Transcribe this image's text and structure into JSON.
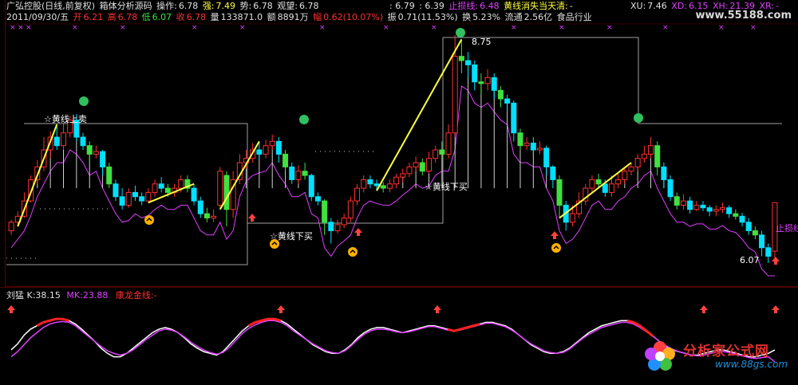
{
  "header": {
    "title": "广弘控股(日线,前复权)",
    "indicator_name": "箱体分析源码",
    "op_label": "操作:",
    "op_value": "6.78",
    "strong_label": "强:",
    "strong_value": "7.49",
    "trend_label": "势:",
    "trend_value": "6.78",
    "watch_label": "观望:",
    "watch_value": "6.78",
    "v1": ": 6.79",
    "v2": ": 6.39",
    "stoploss_label": "止损线:",
    "stoploss_value": "6.48",
    "yellow_gone_label": "黄线消失当天清:",
    "yellow_gone_value": "-",
    "xu_label": "XU:",
    "xu_value": "7.46",
    "xd_label": "XD:",
    "xd_value": "6.15",
    "xh_label": "XH:",
    "xh_value": "21.39",
    "xr_label": "XR:",
    "xr_value": "-",
    "watermark": "www.55188.com",
    "date": "2011/09/30/五",
    "open_label": "开",
    "open_value": "6.21",
    "high_label": "高",
    "high_value": "6.78",
    "low_label": "低",
    "low_value": "6.07",
    "close_label": "收",
    "close_value": "6.78",
    "vol_label": "量",
    "vol_value": "133871.0",
    "amt_label": "额",
    "amt_value": "8891万",
    "chg_label": "幅",
    "chg_value": "0.62(10.07%)",
    "amp_label": "振",
    "amp_value": "0.71(11.53%)",
    "turnover_label": "换",
    "turnover_value": "5.23%",
    "float_label": "流通",
    "float_value": "2.56亿",
    "industry": "食品行业"
  },
  "annotations": {
    "high_price": "8.75",
    "low_price": "6.07",
    "sell_1": "☆黄线上卖",
    "buy_1": "☆黄线下买",
    "buy_2": "☆黄线下买",
    "stoploss_tag": "止损线"
  },
  "sub_panel": {
    "name": "刘猛",
    "k_label": "K:",
    "k_value": "38.15",
    "mk_label": "MK:",
    "mk_value": "23.88",
    "gold_label": "康龙金线:",
    "gold_value": "-"
  },
  "logo": {
    "title": "分析家公式网",
    "url": "www.88gs.com"
  },
  "colors": {
    "up": "#ff3030",
    "down": "#00e0ff",
    "green": "#40e040",
    "yellow": "#ffff40",
    "magenta": "#e040ff",
    "grey_line": "#a0a0a0",
    "white": "#ffffff"
  },
  "chart_data": {
    "type": "candlestick",
    "ylim": [
      6.07,
      8.75
    ],
    "candles": [
      {
        "o": 6.45,
        "c": 6.55,
        "h": 6.58,
        "l": 6.4
      },
      {
        "o": 6.55,
        "c": 6.62,
        "h": 6.68,
        "l": 6.5
      },
      {
        "o": 6.62,
        "c": 6.8,
        "h": 6.9,
        "l": 6.6
      },
      {
        "o": 6.8,
        "c": 7.05,
        "h": 7.1,
        "l": 6.78
      },
      {
        "o": 7.05,
        "c": 7.2,
        "h": 7.28,
        "l": 7.0
      },
      {
        "o": 7.2,
        "c": 7.4,
        "h": 7.55,
        "l": 7.15
      },
      {
        "o": 7.4,
        "c": 7.55,
        "h": 7.62,
        "l": 7.3
      },
      {
        "o": 7.55,
        "c": 7.45,
        "h": 7.7,
        "l": 7.4
      },
      {
        "o": 7.45,
        "c": 7.6,
        "h": 7.72,
        "l": 7.4
      },
      {
        "o": 7.6,
        "c": 7.75,
        "h": 7.8,
        "l": 7.55
      },
      {
        "o": 7.75,
        "c": 7.55,
        "h": 7.82,
        "l": 7.5
      },
      {
        "o": 7.55,
        "c": 7.45,
        "h": 7.6,
        "l": 7.4
      },
      {
        "o": 7.45,
        "c": 7.35,
        "h": 7.5,
        "l": 7.25
      },
      {
        "o": 7.35,
        "c": 7.38,
        "h": 7.45,
        "l": 7.3
      },
      {
        "o": 7.38,
        "c": 7.2,
        "h": 7.4,
        "l": 7.1
      },
      {
        "o": 7.2,
        "c": 7.0,
        "h": 7.25,
        "l": 6.95
      },
      {
        "o": 7.0,
        "c": 6.85,
        "h": 7.05,
        "l": 6.8
      },
      {
        "o": 6.85,
        "c": 6.75,
        "h": 6.95,
        "l": 6.7
      },
      {
        "o": 6.75,
        "c": 6.9,
        "h": 6.95,
        "l": 6.72
      },
      {
        "o": 6.9,
        "c": 6.85,
        "h": 6.98,
        "l": 6.8
      },
      {
        "o": 6.85,
        "c": 6.8,
        "h": 6.9,
        "l": 6.75
      },
      {
        "o": 6.8,
        "c": 6.9,
        "h": 6.95,
        "l": 6.78
      },
      {
        "o": 6.9,
        "c": 7.0,
        "h": 7.05,
        "l": 6.85
      },
      {
        "o": 7.0,
        "c": 6.95,
        "h": 7.08,
        "l": 6.9
      },
      {
        "o": 6.95,
        "c": 6.9,
        "h": 7.0,
        "l": 6.85
      },
      {
        "o": 6.9,
        "c": 6.95,
        "h": 7.0,
        "l": 6.85
      },
      {
        "o": 6.95,
        "c": 7.05,
        "h": 7.1,
        "l": 6.9
      },
      {
        "o": 7.05,
        "c": 6.95,
        "h": 7.1,
        "l": 6.9
      },
      {
        "o": 6.95,
        "c": 6.8,
        "h": 7.0,
        "l": 6.75
      },
      {
        "o": 6.8,
        "c": 6.65,
        "h": 6.85,
        "l": 6.6
      },
      {
        "o": 6.65,
        "c": 6.6,
        "h": 6.72,
        "l": 6.55
      },
      {
        "o": 6.6,
        "c": 6.62,
        "h": 6.7,
        "l": 6.55
      },
      {
        "o": 6.75,
        "c": 7.15,
        "h": 7.2,
        "l": 6.7
      },
      {
        "o": 7.1,
        "c": 6.7,
        "h": 7.15,
        "l": 6.5
      },
      {
        "o": 6.7,
        "c": 7.05,
        "h": 7.15,
        "l": 6.6
      },
      {
        "o": 7.05,
        "c": 7.25,
        "h": 7.35,
        "l": 7.0
      },
      {
        "o": 7.25,
        "c": 7.3,
        "h": 7.4,
        "l": 7.18
      },
      {
        "o": 7.3,
        "c": 7.4,
        "h": 7.48,
        "l": 7.25
      },
      {
        "o": 7.4,
        "c": 7.35,
        "h": 7.5,
        "l": 7.28
      },
      {
        "o": 7.35,
        "c": 7.45,
        "h": 7.52,
        "l": 7.3
      },
      {
        "o": 7.45,
        "c": 7.5,
        "h": 7.58,
        "l": 7.4
      },
      {
        "o": 7.5,
        "c": 7.35,
        "h": 7.55,
        "l": 7.25
      },
      {
        "o": 7.35,
        "c": 7.2,
        "h": 7.4,
        "l": 7.15
      },
      {
        "o": 7.2,
        "c": 7.05,
        "h": 7.25,
        "l": 7.0
      },
      {
        "o": 7.05,
        "c": 7.15,
        "h": 7.22,
        "l": 7.0
      },
      {
        "o": 7.15,
        "c": 7.1,
        "h": 7.25,
        "l": 7.05
      },
      {
        "o": 7.1,
        "c": 6.85,
        "h": 7.12,
        "l": 6.8
      },
      {
        "o": 6.85,
        "c": 6.8,
        "h": 6.9,
        "l": 6.75
      },
      {
        "o": 6.8,
        "c": 6.55,
        "h": 6.82,
        "l": 6.4
      },
      {
        "o": 6.55,
        "c": 6.45,
        "h": 6.6,
        "l": 6.3
      },
      {
        "o": 6.45,
        "c": 6.52,
        "h": 6.58,
        "l": 6.42
      },
      {
        "o": 6.52,
        "c": 6.6,
        "h": 6.65,
        "l": 6.48
      },
      {
        "o": 6.6,
        "c": 6.8,
        "h": 6.85,
        "l": 6.55
      },
      {
        "o": 6.8,
        "c": 6.95,
        "h": 7.0,
        "l": 6.75
      },
      {
        "o": 6.95,
        "c": 7.05,
        "h": 7.1,
        "l": 6.9
      },
      {
        "o": 7.05,
        "c": 7.0,
        "h": 7.1,
        "l": 6.95
      },
      {
        "o": 7.0,
        "c": 6.98,
        "h": 7.05,
        "l": 6.92
      },
      {
        "o": 6.98,
        "c": 6.95,
        "h": 7.02,
        "l": 6.9
      },
      {
        "o": 6.95,
        "c": 7.0,
        "h": 7.05,
        "l": 6.9
      },
      {
        "o": 7.0,
        "c": 7.08,
        "h": 7.12,
        "l": 6.95
      },
      {
        "o": 7.08,
        "c": 7.12,
        "h": 7.18,
        "l": 7.02
      },
      {
        "o": 7.12,
        "c": 7.2,
        "h": 7.25,
        "l": 7.08
      },
      {
        "o": 7.2,
        "c": 7.25,
        "h": 7.32,
        "l": 7.15
      },
      {
        "o": 7.25,
        "c": 7.15,
        "h": 7.3,
        "l": 7.1
      },
      {
        "o": 7.15,
        "c": 7.3,
        "h": 7.38,
        "l": 7.12
      },
      {
        "o": 7.3,
        "c": 7.4,
        "h": 7.45,
        "l": 7.25
      },
      {
        "o": 7.4,
        "c": 7.35,
        "h": 7.5,
        "l": 7.3
      },
      {
        "o": 7.35,
        "c": 7.6,
        "h": 7.7,
        "l": 7.3
      },
      {
        "o": 7.6,
        "c": 8.5,
        "h": 8.75,
        "l": 7.55
      },
      {
        "o": 8.5,
        "c": 8.45,
        "h": 8.7,
        "l": 8.3
      },
      {
        "o": 8.45,
        "c": 8.4,
        "h": 8.55,
        "l": 8.25
      },
      {
        "o": 8.4,
        "c": 8.2,
        "h": 8.45,
        "l": 8.1
      },
      {
        "o": 8.2,
        "c": 8.18,
        "h": 8.3,
        "l": 8.05
      },
      {
        "o": 8.18,
        "c": 8.25,
        "h": 8.35,
        "l": 8.1
      },
      {
        "o": 8.25,
        "c": 8.1,
        "h": 8.3,
        "l": 8.0
      },
      {
        "o": 8.1,
        "c": 8.0,
        "h": 8.15,
        "l": 7.9
      },
      {
        "o": 8.0,
        "c": 7.95,
        "h": 8.05,
        "l": 7.85
      },
      {
        "o": 7.95,
        "c": 7.6,
        "h": 7.98,
        "l": 7.5
      },
      {
        "o": 7.6,
        "c": 7.45,
        "h": 7.65,
        "l": 7.4
      },
      {
        "o": 7.45,
        "c": 7.48,
        "h": 7.55,
        "l": 7.4
      },
      {
        "o": 7.48,
        "c": 7.4,
        "h": 7.55,
        "l": 7.35
      },
      {
        "o": 7.4,
        "c": 7.42,
        "h": 7.5,
        "l": 7.35
      },
      {
        "o": 7.42,
        "c": 7.2,
        "h": 7.45,
        "l": 7.1
      },
      {
        "o": 7.2,
        "c": 7.05,
        "h": 7.22,
        "l": 6.95
      },
      {
        "o": 7.05,
        "c": 6.75,
        "h": 7.1,
        "l": 6.6
      },
      {
        "o": 6.75,
        "c": 6.55,
        "h": 6.8,
        "l": 6.45
      },
      {
        "o": 6.55,
        "c": 6.65,
        "h": 6.75,
        "l": 6.5
      },
      {
        "o": 6.65,
        "c": 6.8,
        "h": 6.9,
        "l": 6.6
      },
      {
        "o": 6.8,
        "c": 6.95,
        "h": 7.0,
        "l": 6.75
      },
      {
        "o": 6.95,
        "c": 7.05,
        "h": 7.1,
        "l": 6.9
      },
      {
        "o": 7.05,
        "c": 7.0,
        "h": 7.12,
        "l": 6.95
      },
      {
        "o": 7.0,
        "c": 6.9,
        "h": 7.05,
        "l": 6.85
      },
      {
        "o": 6.9,
        "c": 7.0,
        "h": 7.1,
        "l": 6.85
      },
      {
        "o": 7.0,
        "c": 7.05,
        "h": 7.12,
        "l": 6.95
      },
      {
        "o": 7.05,
        "c": 7.15,
        "h": 7.2,
        "l": 7.0
      },
      {
        "o": 7.15,
        "c": 7.2,
        "h": 7.25,
        "l": 7.1
      },
      {
        "o": 7.2,
        "c": 7.3,
        "h": 7.35,
        "l": 7.15
      },
      {
        "o": 7.3,
        "c": 7.35,
        "h": 7.45,
        "l": 7.25
      },
      {
        "o": 7.35,
        "c": 7.45,
        "h": 7.55,
        "l": 7.3
      },
      {
        "o": 7.45,
        "c": 7.2,
        "h": 7.5,
        "l": 7.1
      },
      {
        "o": 7.2,
        "c": 7.05,
        "h": 7.25,
        "l": 6.95
      },
      {
        "o": 7.05,
        "c": 6.85,
        "h": 7.1,
        "l": 6.8
      },
      {
        "o": 6.85,
        "c": 6.75,
        "h": 6.9,
        "l": 6.7
      },
      {
        "o": 6.75,
        "c": 6.8,
        "h": 6.88,
        "l": 6.7
      },
      {
        "o": 6.8,
        "c": 6.7,
        "h": 6.85,
        "l": 6.65
      },
      {
        "o": 6.7,
        "c": 6.75,
        "h": 6.8,
        "l": 6.68
      },
      {
        "o": 6.75,
        "c": 6.72,
        "h": 6.8,
        "l": 6.68
      },
      {
        "o": 6.72,
        "c": 6.68,
        "h": 6.75,
        "l": 6.62
      },
      {
        "o": 6.68,
        "c": 6.7,
        "h": 6.75,
        "l": 6.62
      },
      {
        "o": 6.7,
        "c": 6.72,
        "h": 6.78,
        "l": 6.66
      },
      {
        "o": 6.72,
        "c": 6.65,
        "h": 6.75,
        "l": 6.6
      },
      {
        "o": 6.65,
        "c": 6.62,
        "h": 6.7,
        "l": 6.58
      },
      {
        "o": 6.62,
        "c": 6.55,
        "h": 6.66,
        "l": 6.5
      },
      {
        "o": 6.55,
        "c": 6.45,
        "h": 6.6,
        "l": 6.4
      },
      {
        "o": 6.45,
        "c": 6.4,
        "h": 6.5,
        "l": 6.35
      },
      {
        "o": 6.4,
        "c": 6.25,
        "h": 6.45,
        "l": 6.15
      },
      {
        "o": 6.25,
        "c": 6.15,
        "h": 6.3,
        "l": 6.07
      },
      {
        "o": 6.21,
        "c": 6.78,
        "h": 6.78,
        "l": 6.07
      }
    ],
    "k_series": [
      38,
      45,
      55,
      62,
      66,
      70,
      72,
      74,
      74,
      72,
      68,
      62,
      55,
      48,
      40,
      34,
      30,
      30,
      34,
      40,
      46,
      52,
      58,
      62,
      64,
      62,
      58,
      52,
      45,
      40,
      36,
      34,
      32,
      36,
      44,
      52,
      60,
      66,
      70,
      72,
      74,
      74,
      72,
      68,
      62,
      56,
      50,
      44,
      40,
      36,
      34,
      34,
      38,
      44,
      52,
      58,
      62,
      64,
      64,
      62,
      60,
      58,
      60,
      62,
      64,
      66,
      66,
      64,
      62,
      60,
      62,
      64,
      66,
      68,
      70,
      70,
      68,
      66,
      62,
      56,
      50,
      44,
      40,
      36,
      34,
      34,
      36,
      40,
      46,
      52,
      58,
      62,
      66,
      68,
      70,
      72,
      72,
      70,
      66,
      60,
      54,
      48,
      42,
      38,
      36,
      34,
      32,
      32,
      34,
      36,
      38,
      38,
      36,
      34,
      32,
      30,
      30,
      32,
      34,
      38
    ],
    "mk_series": [
      30,
      36,
      44,
      52,
      58,
      64,
      68,
      70,
      71,
      70,
      66,
      60,
      54,
      48,
      42,
      37,
      34,
      32,
      34,
      38,
      44,
      50,
      55,
      60,
      62,
      61,
      58,
      53,
      47,
      42,
      38,
      35,
      33,
      35,
      41,
      49,
      57,
      63,
      67,
      70,
      72,
      72,
      70,
      66,
      60,
      55,
      50,
      45,
      41,
      37,
      35,
      34,
      37,
      43,
      50,
      56,
      60,
      62,
      62,
      61,
      59,
      58,
      59,
      61,
      63,
      65,
      65,
      63,
      61,
      60,
      61,
      63,
      65,
      67,
      69,
      69,
      67,
      65,
      61,
      56,
      50,
      45,
      41,
      37,
      35,
      34,
      35,
      39,
      45,
      51,
      56,
      60,
      64,
      66,
      68,
      70,
      70,
      68,
      64,
      59,
      54,
      48,
      43,
      39,
      36,
      34,
      32,
      31,
      32,
      34,
      36,
      36,
      35,
      33,
      31,
      29,
      28,
      29,
      30,
      24
    ]
  }
}
